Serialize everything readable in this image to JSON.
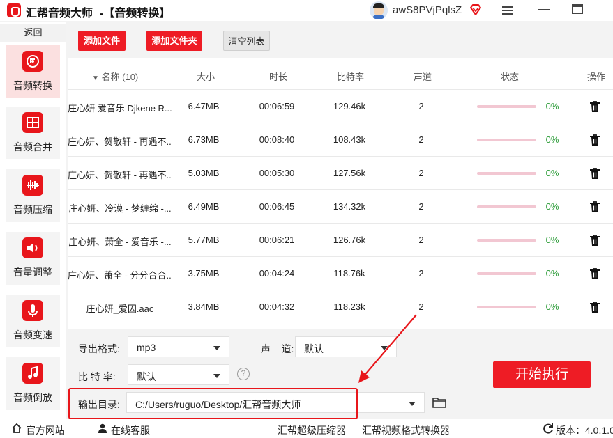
{
  "app": {
    "title": "汇帮音频大师",
    "subtitle": "-【音频转换】",
    "user_name": "awS8PVjPqlsZ",
    "accent_color": "#e8161b"
  },
  "sidebar": {
    "back_label": "返回",
    "items": [
      {
        "label": "音频转换",
        "icon": "audio-convert-icon",
        "active": true
      },
      {
        "label": "音频合并",
        "icon": "audio-merge-icon",
        "active": false
      },
      {
        "label": "音频压缩",
        "icon": "audio-compress-icon",
        "active": false
      },
      {
        "label": "音量调整",
        "icon": "volume-icon",
        "active": false
      },
      {
        "label": "音频变速",
        "icon": "microphone-icon",
        "active": false
      },
      {
        "label": "音频倒放",
        "icon": "music-note-icon",
        "active": false
      }
    ]
  },
  "toolbar": {
    "add_file": "添加文件",
    "add_folder": "添加文件夹",
    "clear_list": "清空列表"
  },
  "table": {
    "headers": {
      "name": "名称 (10)",
      "size": "大小",
      "duration": "时长",
      "bitrate": "比特率",
      "channels": "声道",
      "status": "状态",
      "action": "操作"
    },
    "rows": [
      {
        "name": "庄心妍 爱音乐 Djkene R...",
        "size": "6.47MB",
        "duration": "00:06:59",
        "bitrate": "129.46k",
        "channels": "2",
        "progress": 0,
        "progress_text": "0%"
      },
      {
        "name": "庄心妍、贺敬轩 - 再遇不...",
        "size": "6.73MB",
        "duration": "00:08:40",
        "bitrate": "108.43k",
        "channels": "2",
        "progress": 0,
        "progress_text": "0%"
      },
      {
        "name": "庄心妍、贺敬轩 - 再遇不...",
        "size": "5.03MB",
        "duration": "00:05:30",
        "bitrate": "127.56k",
        "channels": "2",
        "progress": 0,
        "progress_text": "0%"
      },
      {
        "name": "庄心妍、冷漠 - 梦缠绵 -...",
        "size": "6.49MB",
        "duration": "00:06:45",
        "bitrate": "134.32k",
        "channels": "2",
        "progress": 0,
        "progress_text": "0%"
      },
      {
        "name": "庄心妍、萧全 - 爱音乐 -...",
        "size": "5.77MB",
        "duration": "00:06:21",
        "bitrate": "126.76k",
        "channels": "2",
        "progress": 0,
        "progress_text": "0%"
      },
      {
        "name": "庄心妍、萧全 - 分分合合...",
        "size": "3.75MB",
        "duration": "00:04:24",
        "bitrate": "118.76k",
        "channels": "2",
        "progress": 0,
        "progress_text": "0%"
      },
      {
        "name": "庄心妍_爱囚.aac",
        "size": "3.84MB",
        "duration": "00:04:32",
        "bitrate": "118.23k",
        "channels": "2",
        "progress": 0,
        "progress_text": "0%"
      }
    ]
  },
  "settings": {
    "format_label": "导出格式:",
    "format_value": "mp3",
    "channel_label": "声    道:",
    "channel_value": "默认",
    "bitrate_label": "比 特 率:",
    "bitrate_value": "默认",
    "output_label": "输出目录:",
    "output_value": "C:/Users/ruguo/Desktop/汇帮音频大师",
    "start_label": "开始执行"
  },
  "footer": {
    "website": "官方网站",
    "support": "在线客服",
    "compressor": "汇帮超级压缩器",
    "video_converter": "汇帮视频格式转换器",
    "version": "版本：4.0.1.0"
  }
}
